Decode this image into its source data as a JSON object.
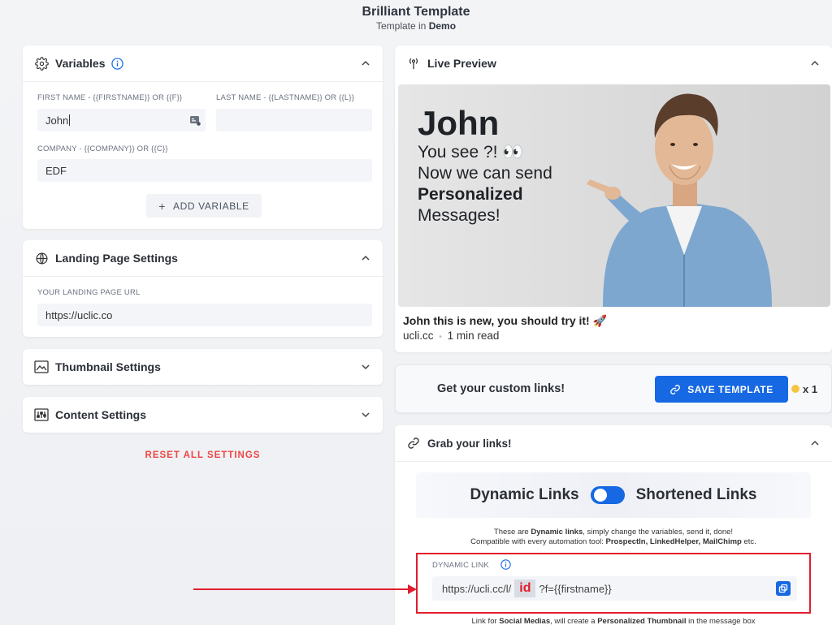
{
  "header": {
    "title": "Brilliant Template",
    "sub_prefix": "Template in",
    "sub_bold": "Demo"
  },
  "variables": {
    "title": "Variables",
    "firstname_label": "FIRST NAME - {{firstname}} or {{f}}",
    "firstname_value": "John",
    "lastname_label": "LAST NAME - {{lastname}} or {{l}}",
    "lastname_value": "",
    "company_label": "COMPANY - {{company}} or {{c}}",
    "company_value": "EDF",
    "add_label": "ADD VARIABLE"
  },
  "landing": {
    "title": "Landing Page Settings",
    "url_label": "YOUR LANDING PAGE URL",
    "url_value": "https://uclic.co"
  },
  "thumbnail": {
    "title": "Thumbnail Settings"
  },
  "content": {
    "title": "Content Settings"
  },
  "reset_label": "RESET ALL SETTINGS",
  "preview": {
    "title": "Live Preview",
    "img_name": "John",
    "img_line1": "You see ?! 👀",
    "img_line2": "Now we can send",
    "img_line3": "Personalized",
    "img_line4": "Messages!",
    "caption": "John this is new, you should try it! 🚀",
    "domain": "ucli.cc",
    "dot": "•",
    "read_time": "1 min read"
  },
  "save_bar": {
    "text": "Get your custom links!",
    "button": "SAVE TEMPLATE",
    "count": "x 1"
  },
  "grab": {
    "title": "Grab your links!",
    "toggle_left": "Dynamic Links",
    "toggle_right": "Shortened Links",
    "info1_a": "These are",
    "info1_b": "Dynamic links",
    "info1_c": ", simply change the variables, send it, done!",
    "info2_a": "Compatible with every automation tool:",
    "info2_b": "ProspectIn, LinkedHelper, MailChimp",
    "info2_c": "etc.",
    "dyn_label": "DYNAMIC LINK",
    "link_prefix": "https://ucli.cc/l/",
    "link_id": "id",
    "link_suffix": "?f={{firstname}}",
    "footer_a": "Link for",
    "footer_b": "Social Medias",
    "footer_c": ", will create a",
    "footer_d": "Personalized Thumbnail",
    "footer_e": "in the message box"
  },
  "colors": {
    "accent": "#1668e3",
    "danger": "#ef4444",
    "highlight_border": "#e11d2e"
  }
}
